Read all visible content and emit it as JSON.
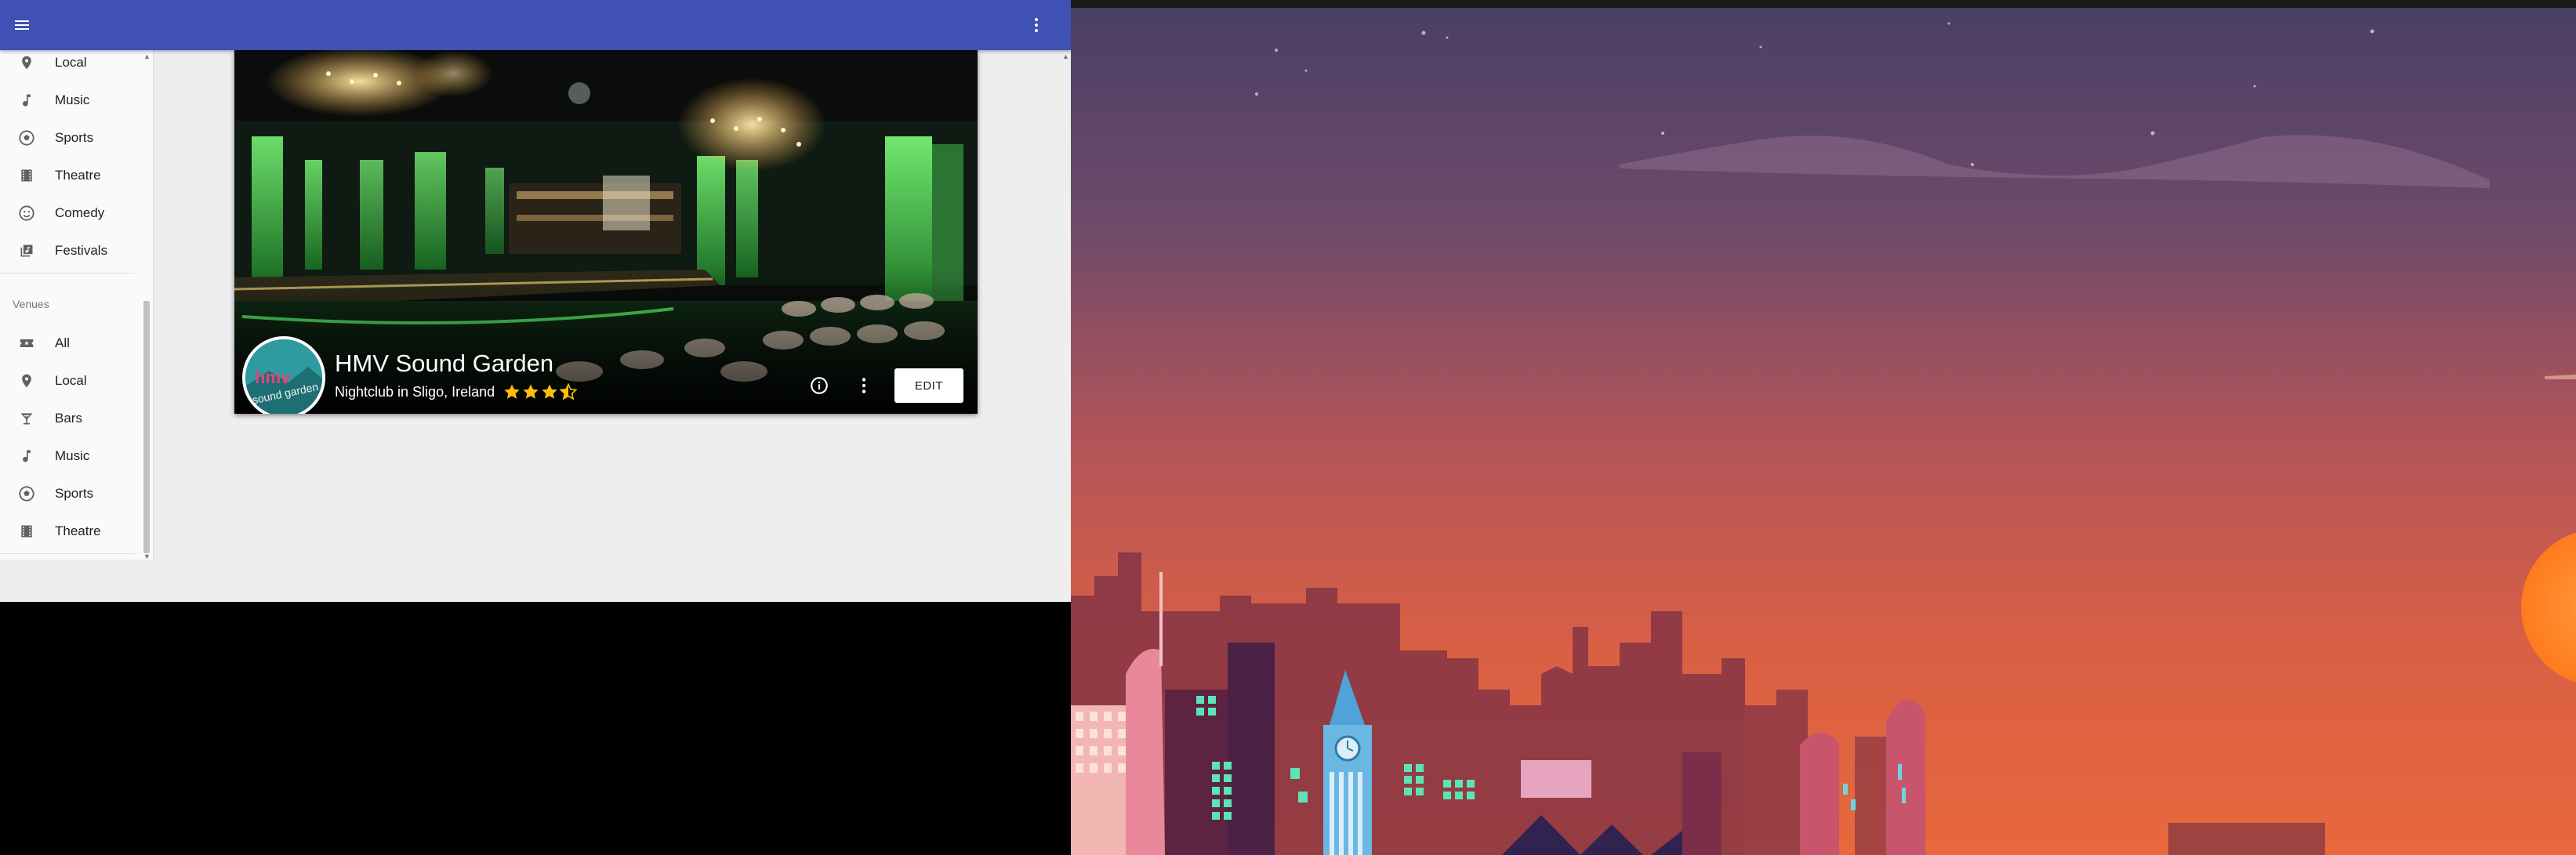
{
  "drawer": {
    "events_items": [
      {
        "label": "Local",
        "icon": "place-icon"
      },
      {
        "label": "Music",
        "icon": "music-note-icon"
      },
      {
        "label": "Sports",
        "icon": "soccer-ball-icon"
      },
      {
        "label": "Theatre",
        "icon": "theater-icon"
      },
      {
        "label": "Comedy",
        "icon": "smiley-icon"
      },
      {
        "label": "Festivals",
        "icon": "library-music-icon"
      }
    ],
    "venues_header": "Venues",
    "venues_items": [
      {
        "label": "All",
        "icon": "ticket-icon"
      },
      {
        "label": "Local",
        "icon": "place-icon"
      },
      {
        "label": "Bars",
        "icon": "cocktail-icon"
      },
      {
        "label": "Music",
        "icon": "music-note-icon"
      },
      {
        "label": "Sports",
        "icon": "soccer-ball-icon"
      },
      {
        "label": "Theatre",
        "icon": "theater-icon"
      }
    ]
  },
  "card": {
    "title": "HMV Sound Garden",
    "subtitle": "Nightclub in Sligo, Ireland",
    "rating": 3.5,
    "rating_max": 4,
    "avatar_text": "hmv sound garden",
    "edit_label": "EDIT"
  },
  "colors": {
    "appbar": "#3f51b5",
    "star": "#ffc107"
  }
}
